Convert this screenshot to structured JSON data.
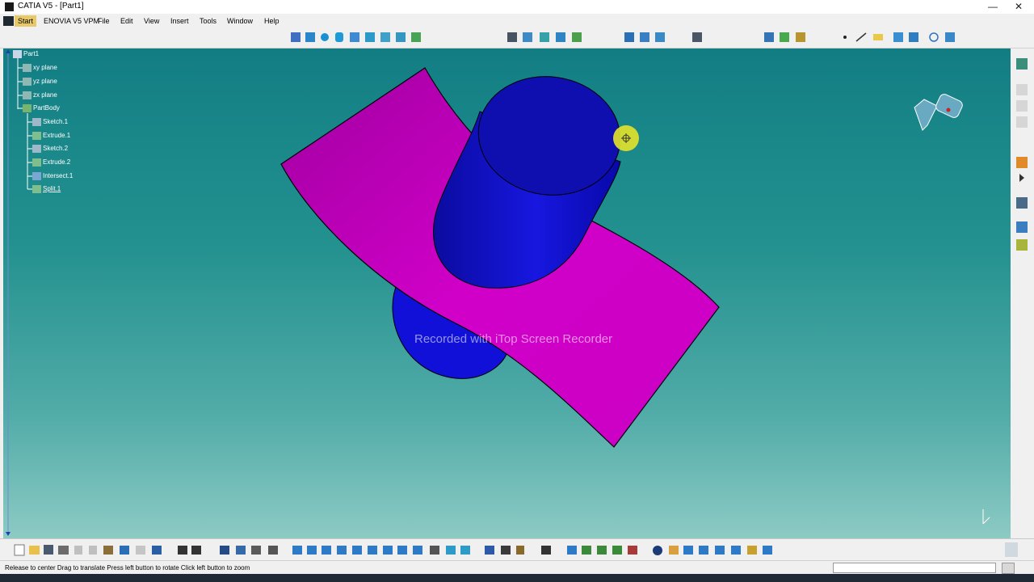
{
  "window": {
    "title": "CATIA V5 - [Part1]"
  },
  "window_controls": {
    "minimize": "—",
    "maximize": "☐",
    "close": "✕"
  },
  "menu": [
    "Start",
    "ENOVIA V5 VPM",
    "File",
    "Edit",
    "View",
    "Insert",
    "Tools",
    "Window",
    "Help"
  ],
  "tree": {
    "root": "Part1",
    "nodes": [
      "xy plane",
      "yz plane",
      "zx plane",
      "PartBody",
      "Sketch.1",
      "Extrude.1",
      "Sketch.2",
      "Extrude.2",
      "Intersect.1",
      "Split.1"
    ]
  },
  "watermark": "Recorded with iTop Screen Recorder",
  "status": {
    "text": "Release to center  Drag to translate  Press left button to rotate  Click left button to zoom",
    "command_input": ""
  },
  "colors": {
    "viewport_top": "#127e84",
    "viewport_bottom": "#8dcac4",
    "surface": "#d000c8",
    "cylinder": "#1010d8",
    "cursor": "#e6e32a"
  },
  "icons": [
    "catia-app-icon",
    "start-logo",
    "toolbar-tools",
    "compass-icon",
    "split-surface-icon",
    "cylinder-part"
  ]
}
